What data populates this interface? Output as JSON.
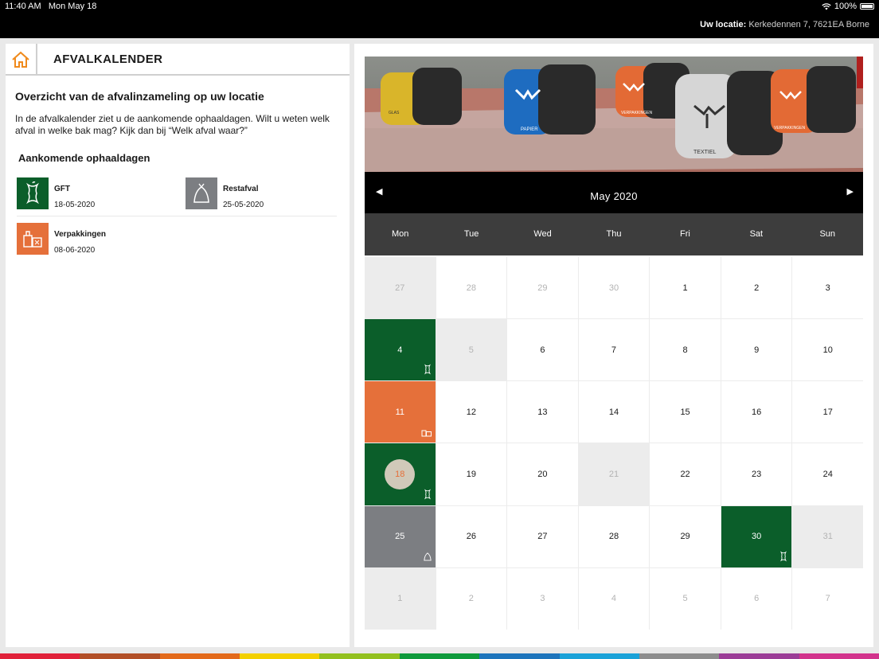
{
  "status": {
    "time": "11:40 AM",
    "date": "Mon May 18",
    "battery": "100%"
  },
  "header": {
    "location_label": "Uw locatie:",
    "location_value": "Kerkedennen 7, 7621EA Borne"
  },
  "left": {
    "title": "AFVALKALENDER",
    "overview_title": "Overzicht van de afvalinzameling op uw locatie",
    "intro": "In de afvalkalender ziet u de aankomende ophaaldagen. Wilt u weten welk afval in welke bak mag? Kijk dan bij “Welk afval waar?”",
    "upcoming_title": "Aankomende ophaaldagen",
    "pickups": [
      {
        "name": "GFT",
        "date": "18-05-2020",
        "color": "#0b5e2a",
        "icon": "apple-core-icon"
      },
      {
        "name": "Restafval",
        "date": "25-05-2020",
        "color": "#7c7e82",
        "icon": "trash-bag-icon"
      },
      {
        "name": "Verpakkingen",
        "date": "08-06-2020",
        "color": "#e5703a",
        "icon": "packaging-icon"
      }
    ]
  },
  "calendar": {
    "month": "May 2020",
    "prev": "◀",
    "next": "▶",
    "weekdays": [
      "Mon",
      "Tue",
      "Wed",
      "Thu",
      "Fri",
      "Sat",
      "Sun"
    ],
    "weeks": [
      [
        {
          "d": "27",
          "style": "grey",
          "muted": true
        },
        {
          "d": "28",
          "muted": true
        },
        {
          "d": "29",
          "muted": true
        },
        {
          "d": "30",
          "muted": true
        },
        {
          "d": "1"
        },
        {
          "d": "2"
        },
        {
          "d": "3"
        }
      ],
      [
        {
          "d": "4",
          "style": "gft",
          "icon": "gft"
        },
        {
          "d": "5",
          "style": "grey",
          "muted": true
        },
        {
          "d": "6"
        },
        {
          "d": "7"
        },
        {
          "d": "8"
        },
        {
          "d": "9"
        },
        {
          "d": "10"
        }
      ],
      [
        {
          "d": "11",
          "style": "pack",
          "icon": "pack"
        },
        {
          "d": "12"
        },
        {
          "d": "13"
        },
        {
          "d": "14"
        },
        {
          "d": "15"
        },
        {
          "d": "16"
        },
        {
          "d": "17"
        }
      ],
      [
        {
          "d": "18",
          "style": "gft",
          "icon": "gft",
          "today": true
        },
        {
          "d": "19"
        },
        {
          "d": "20"
        },
        {
          "d": "21",
          "style": "grey",
          "muted": true
        },
        {
          "d": "22"
        },
        {
          "d": "23"
        },
        {
          "d": "24"
        }
      ],
      [
        {
          "d": "25",
          "style": "rest",
          "icon": "rest"
        },
        {
          "d": "26"
        },
        {
          "d": "27"
        },
        {
          "d": "28"
        },
        {
          "d": "29"
        },
        {
          "d": "30",
          "style": "gft",
          "icon": "gft"
        },
        {
          "d": "31",
          "style": "grey",
          "muted": true
        }
      ],
      [
        {
          "d": "1",
          "style": "grey",
          "muted": true
        },
        {
          "d": "2",
          "muted": true
        },
        {
          "d": "3",
          "muted": true
        },
        {
          "d": "4",
          "muted": true
        },
        {
          "d": "5",
          "muted": true
        },
        {
          "d": "6",
          "muted": true
        },
        {
          "d": "7",
          "muted": true
        }
      ]
    ]
  },
  "photo": {
    "labels": [
      "GLAS",
      "PAPIER",
      "VERPAKKINGEN",
      "TEXTIEL",
      "VERPAKKINGEN"
    ]
  },
  "colors": {
    "accent": "#f08a1c",
    "gft": "#0b5e2a",
    "packaging": "#e5703a",
    "rest": "#7c7e82",
    "stripe": [
      "#e0223a",
      "#b24f27",
      "#e36a1b",
      "#f3d000",
      "#92c01f",
      "#0f9a3c",
      "#1d74bb",
      "#1aa2d8",
      "#8d8d8d",
      "#9b3d97",
      "#d2338c"
    ]
  }
}
